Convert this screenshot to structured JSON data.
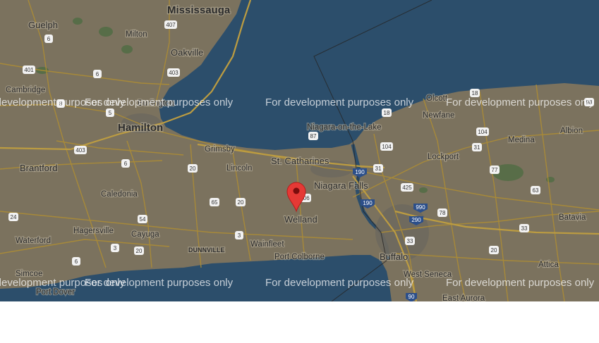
{
  "map": {
    "watermark": "For development purposes only",
    "colors": {
      "water": "#33597a",
      "land": "#8c826c",
      "road": "#c8a23a",
      "marker": "#e53935"
    },
    "marker": {
      "name": "Welland",
      "icon": "map-pin-icon"
    },
    "cities": {
      "mississauga": "Mississauga",
      "guelph": "Guelph",
      "milton": "Milton",
      "oakville": "Oakville",
      "cambridge": "Cambridge",
      "burlington": "Burlington",
      "hamilton": "Hamilton",
      "grimsby": "Grimsby",
      "brantford": "Brantford",
      "lincoln": "Lincoln",
      "st_catharines": "St. Catharines",
      "niagara_on_the_lake": "Niagara-on-the-Lake",
      "niagara_falls": "Niagara Falls",
      "welland": "Welland",
      "caledonia": "Caledonia",
      "hagersville": "Hagersville",
      "cayuga": "Cayuga",
      "waterford": "Waterford",
      "dunnville": "DUNNVILLE",
      "wainfleet": "Wainfleet",
      "port_colborne": "Port Colborne",
      "simcoe": "Simcoe",
      "port_dover": "Port Dover",
      "buffalo": "Buffalo",
      "west_seneca": "West Seneca",
      "east_aurora": "East Aurora",
      "olcott": "Olcott",
      "newfane": "Newfane",
      "lockport": "Lockport",
      "medina": "Medina",
      "albion": "Albion",
      "batavia": "Batavia",
      "attica": "Attica"
    },
    "shields": {
      "s407": "407",
      "s6a": "6",
      "s401": "401",
      "s403a": "403",
      "s6b": "6",
      "s8": "8",
      "s5": "5",
      "s403b": "403",
      "s6c": "6",
      "s20a": "20",
      "s65": "65",
      "s20b": "20",
      "s54": "54",
      "s3a": "3",
      "s3b": "3",
      "s20c": "20",
      "s24": "24",
      "s6d": "6",
      "s87": "87",
      "s406": "406",
      "s190a": "190",
      "s31a": "31",
      "s104a": "104",
      "s18a": "18",
      "s18b": "18",
      "s104b": "104",
      "s31b": "31",
      "s77": "77",
      "s63": "63",
      "s98": "98",
      "s425": "425",
      "s990": "990",
      "s290": "290",
      "s190b": "190",
      "s78": "78",
      "s33a": "33",
      "s33b": "33",
      "s20d": "20",
      "s90": "90"
    }
  }
}
